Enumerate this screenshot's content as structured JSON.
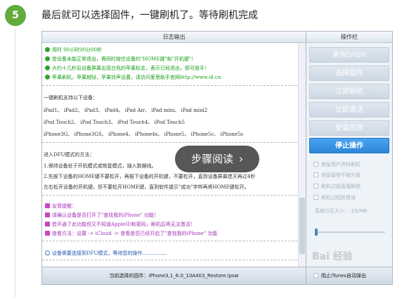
{
  "step": {
    "number": "5",
    "text": "最后就可以选择固件，一键刷机了。等待刷机完成"
  },
  "log_panel": {
    "title": "日志输出",
    "lines_top": [
      "用时 00小时00分00秒",
      "若设备未能正常退出，需同时按住设备的\"HOME键\"和\"开机键\"！",
      "大约十几秒后设备屏幕出现白色的苹果标志，表示已经退出，即可放手！",
      "苹果刷机，苹果越狱，苹果铃声设置，请访问爱思助手官网http://www.i4.cn"
    ],
    "supported_title": "一键刷机支持以下设备：",
    "supported_rows": [
      "iPad1、 iPad2、 iPad3、 iPad4、  iPad Air、  iPad mini、  iPad mini2",
      "iPod Touch2、  iPod Touch3、  iPod Touch4、  iPod Touch5",
      "iPhone3G、 iPhone3GS、 iPhone4、 iPhone4s、 iPhone5、 iPhone5c、 iPhone5s"
    ],
    "dfu_title": "进入DFU模式的方法：",
    "dfu_steps": [
      "1.保持设备处于开机模式或恢复模式，插入数据线。",
      "2.先按下设备的HOME键不要松开，再按下设备的开机键，不要松开，直到设备屏幕熄灭再过4秒",
      "  左右松开设备的开机键，但不要松开HOME键，直到软件提示\"成功\"字样再将HOME键松开。"
    ],
    "tips": [
      "友情提醒：",
      "请确认设备是否打开了\"查找我的iPhone\" 功能!",
      "若开通了此功能但又不知道AppleID和密码，刷机后将无法激活!",
      "查看方法：设置  -> iCloud -> 查看是否已经开启了\"查找我的iPhone\" 功能"
    ],
    "status_line": "设备需要连接到DFU模式，等待您的操作................",
    "firmware_label": "当前选择的固件：",
    "firmware_value": "iPhone3,1_6.0_10A403_Restore.ipsw"
  },
  "ctrl_panel": {
    "title": "操作栏",
    "buttons": [
      "查询SHSH",
      "选择固件",
      "立即刷机",
      "立即激活",
      "安装应用",
      "停止操作"
    ],
    "options": [
      "保留用户资料刷机",
      "保留基带不被升级",
      "刷机过程直接解锁",
      "刷机过程防错误",
      "系统分区大小：  1G/MB"
    ],
    "footer": "阻止iTunes自动弹出"
  },
  "overlay": {
    "text": "步骤阅读",
    "chevron": "›"
  },
  "watermark": "Bai 经验",
  "colors": {
    "step_green": "#62ab3c",
    "active_button": "#2b86d8",
    "log_green": "#18a018",
    "log_purple": "#a533b8"
  }
}
